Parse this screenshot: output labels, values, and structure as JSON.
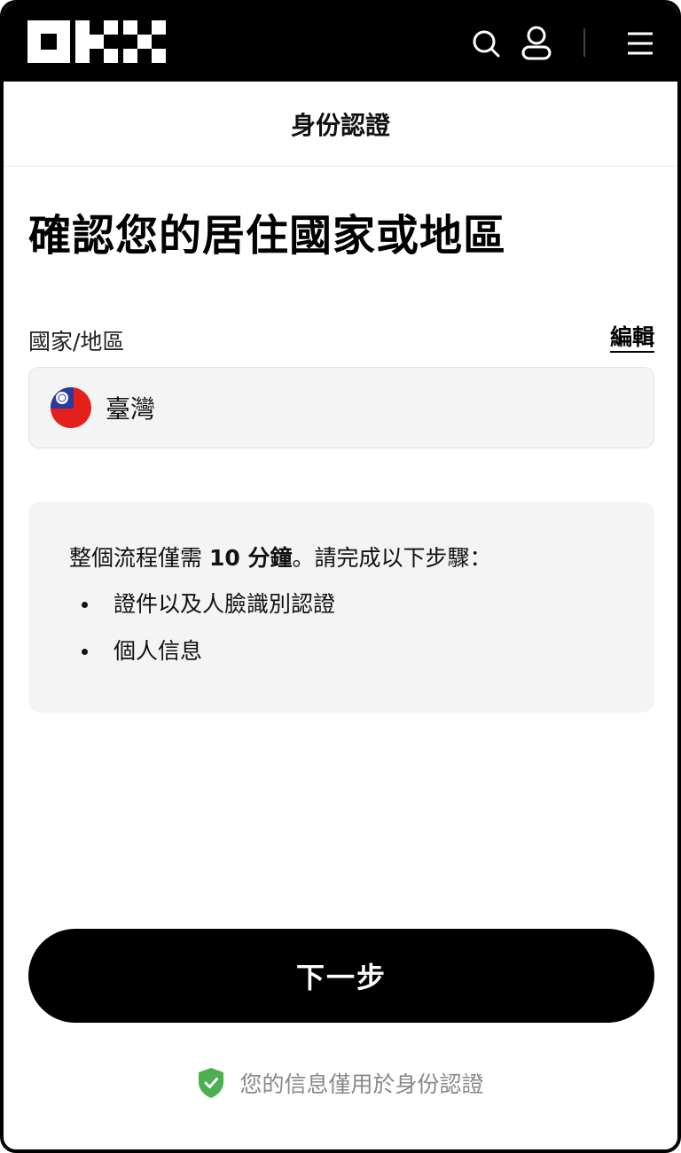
{
  "topbar": {
    "logo_icon": "okx-logo",
    "search_icon": "search-icon",
    "user_icon": "user-icon",
    "menu_icon": "menu-icon",
    "background": "#000000"
  },
  "header": {
    "title": "身份認證"
  },
  "main": {
    "title": "確認您的居住國家或地區",
    "country_label": "國家/地區",
    "edit_label": "編輯",
    "country": {
      "flag_icon": "taiwan-flag-icon",
      "name": "臺灣"
    }
  },
  "info": {
    "intro_before": "整個流程僅需 ",
    "intro_bold": "10 分鐘",
    "intro_after": "。請完成以下步驟：",
    "steps": [
      "證件以及人臉識別認證",
      "個人信息"
    ]
  },
  "next_button": {
    "label": "下一步"
  },
  "privacy": {
    "icon": "shield-check-icon",
    "text": "您的信息僅用於身份認證",
    "icon_color": "#4caf50"
  }
}
